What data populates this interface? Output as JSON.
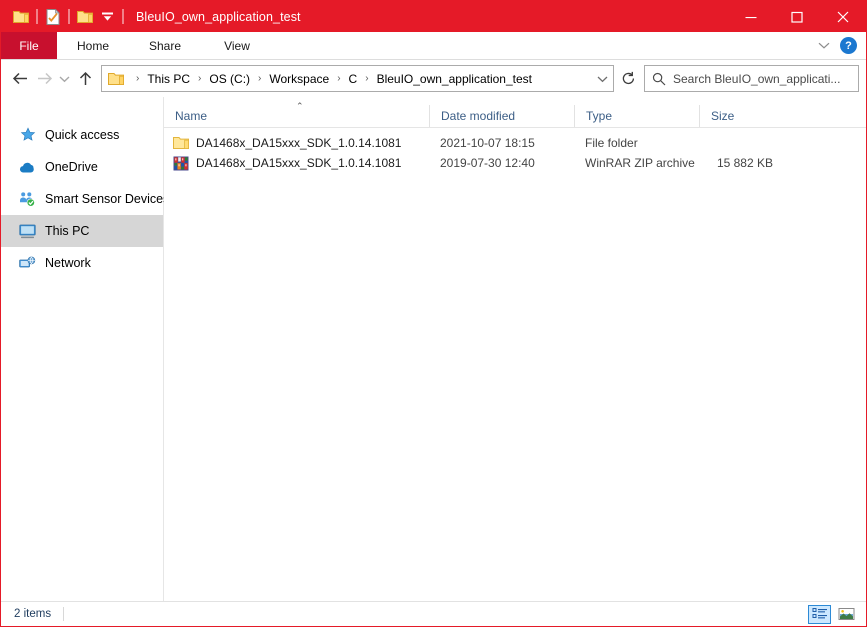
{
  "window": {
    "title": "BleuIO_own_application_test",
    "accent_color": "#E51A28",
    "file_tab_color": "#C8102E",
    "controls": {
      "minimize": "minimize-button",
      "maximize": "maximize-button",
      "close": "close-button"
    }
  },
  "quick_access_toolbar": {
    "items": [
      {
        "name": "folder-icon",
        "label": ""
      },
      {
        "name": "properties-icon",
        "label": ""
      },
      {
        "name": "new-folder-icon",
        "label": ""
      },
      {
        "name": "chevron-down-icon",
        "label": ""
      }
    ]
  },
  "ribbon": {
    "tabs": [
      {
        "label": "File",
        "selected": true
      },
      {
        "label": "Home",
        "selected": false
      },
      {
        "label": "Share",
        "selected": false
      },
      {
        "label": "View",
        "selected": false
      }
    ],
    "collapse_label": "",
    "help_label": "?"
  },
  "address_bar": {
    "back_label": "",
    "forward_label": "",
    "recent_label": "",
    "up_label": "",
    "refresh_label": "",
    "crumbs": [
      "This PC",
      "OS (C:)",
      "Workspace",
      "C",
      "BleuIO_own_application_test"
    ],
    "separator": "›"
  },
  "search": {
    "placeholder": "Search BleuIO_own_applicati...",
    "value": ""
  },
  "sidebar": {
    "items": [
      {
        "label": "Quick access",
        "icon": "star-icon",
        "selected": false
      },
      {
        "label": "OneDrive",
        "icon": "cloud-icon",
        "selected": false
      },
      {
        "label": "Smart Sensor Devices",
        "icon": "sync-folder-icon",
        "selected": false
      },
      {
        "label": "This PC",
        "icon": "monitor-icon",
        "selected": true
      },
      {
        "label": "Network",
        "icon": "network-icon",
        "selected": false
      }
    ]
  },
  "file_list": {
    "columns": [
      {
        "label": "Name",
        "sort": "asc"
      },
      {
        "label": "Date modified",
        "sort": ""
      },
      {
        "label": "Type",
        "sort": ""
      },
      {
        "label": "Size",
        "sort": ""
      }
    ],
    "sort_caret": "⌃",
    "rows": [
      {
        "name": "DA1468x_DA15xxx_SDK_1.0.14.1081",
        "date_modified": "2021-10-07 18:15",
        "type": "File folder",
        "size": "",
        "icon": "folder-icon"
      },
      {
        "name": "DA1468x_DA15xxx_SDK_1.0.14.1081",
        "date_modified": "2019-07-30 12:40",
        "type": "WinRAR ZIP archive",
        "size": "15 882 KB",
        "icon": "winrar-archive-icon"
      }
    ]
  },
  "status_bar": {
    "item_count": "2 items",
    "view_details_label": "",
    "view_large_icons_label": ""
  }
}
